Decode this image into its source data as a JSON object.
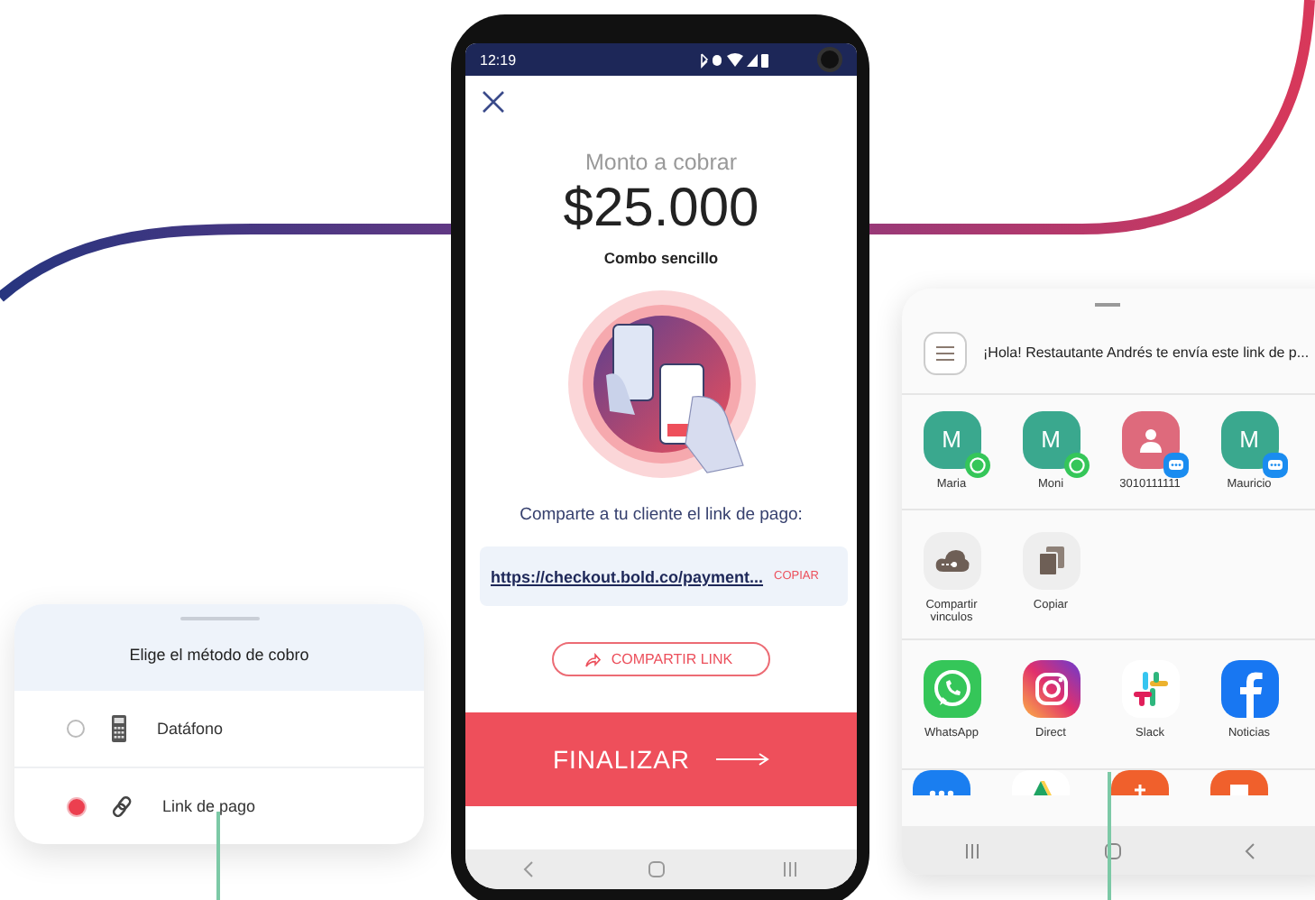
{
  "method_picker": {
    "title": "Elige el método de cobro",
    "options": [
      {
        "label": "Datáfono",
        "kind": "terminal",
        "selected": false
      },
      {
        "label": "Link de pago",
        "kind": "link",
        "selected": true
      }
    ]
  },
  "payment_screen": {
    "status_bar": {
      "time": "12:19"
    },
    "label": "Monto a cobrar",
    "amount": "$25.000",
    "description": "Combo sencillo",
    "share_prompt": "Comparte a tu cliente el link de pago:",
    "link": "https://checkout.bold.co/payment...",
    "copy_button": "COPIAR",
    "share_button": "COMPARTIR LINK",
    "finish_button": "FINALIZAR"
  },
  "share_sheet": {
    "message": "¡Hola! Restautante Andrés te envía este link de p...",
    "contacts": [
      {
        "name": "Maria",
        "initial": "M",
        "color": "#3aa88e",
        "kind": "whatsapp"
      },
      {
        "name": "Moni",
        "initial": "M",
        "color": "#3aa88e",
        "kind": "whatsapp"
      },
      {
        "name": "3010111111",
        "color": "#de6a7c",
        "kind": "messages"
      },
      {
        "name": "Mauricio",
        "initial": "M",
        "color": "#3aa88e",
        "kind": "messages"
      }
    ],
    "actions": [
      {
        "label": "Compartir vinculos",
        "kind": "cloud"
      },
      {
        "label": "Copiar",
        "kind": "copy"
      }
    ],
    "apps": [
      {
        "label": "WhatsApp",
        "kind": "whatsapp"
      },
      {
        "label": "Direct",
        "kind": "instagram"
      },
      {
        "label": "Slack",
        "kind": "slack"
      },
      {
        "label": "Noticias",
        "kind": "facebook"
      }
    ]
  }
}
